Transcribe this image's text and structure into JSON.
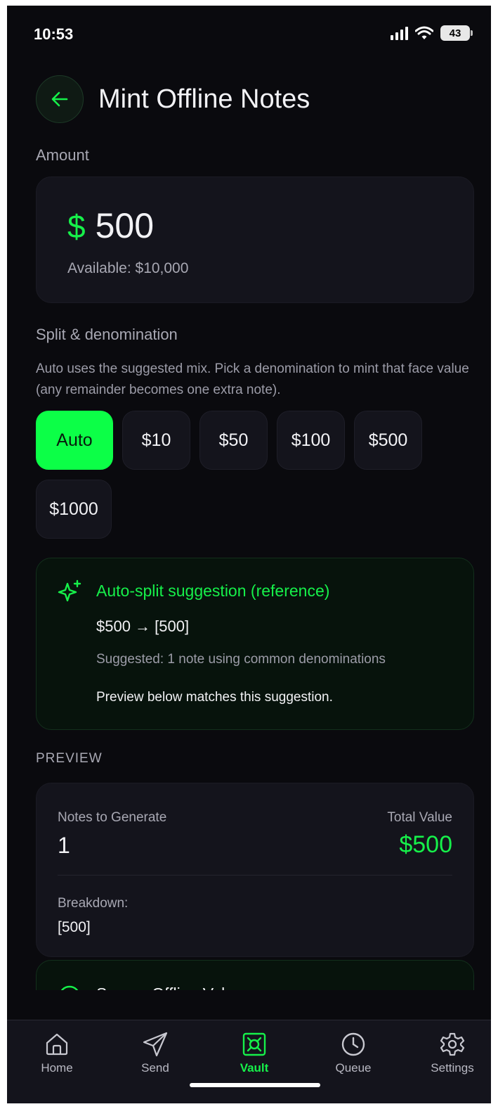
{
  "status_bar": {
    "time": "10:53",
    "battery": "43"
  },
  "header": {
    "title": "Mint Offline Notes"
  },
  "amount": {
    "label": "Amount",
    "currency_symbol": "$",
    "value": "500",
    "available": "Available: $10,000"
  },
  "split": {
    "label": "Split & denomination",
    "description": "Auto uses the suggested mix. Pick a denomination to mint that face value (any remainder becomes one extra note).",
    "options": [
      "Auto",
      "$10",
      "$50",
      "$100",
      "$500",
      "$1000"
    ],
    "selected": "Auto"
  },
  "suggestion": {
    "title": "Auto-split suggestion (reference)",
    "formula": "$500 → [500]",
    "subtitle": "Suggested: 1 note using common denominations",
    "note": "Preview below matches this suggestion."
  },
  "preview": {
    "label": "PREVIEW",
    "notes_label": "Notes to Generate",
    "notes_value": "1",
    "total_label": "Total Value",
    "total_value": "$500",
    "breakdown_label": "Breakdown:",
    "breakdown_value": "[500]"
  },
  "secure_card": {
    "title": "Secure Offline Value"
  },
  "tab_bar": {
    "items": [
      {
        "label": "Home",
        "icon": "home-icon"
      },
      {
        "label": "Send",
        "icon": "send-icon"
      },
      {
        "label": "Vault",
        "icon": "vault-icon",
        "active": true
      },
      {
        "label": "Queue",
        "icon": "clock-icon"
      },
      {
        "label": "Settings",
        "icon": "gear-icon"
      }
    ]
  },
  "colors": {
    "accent": "#16f04a",
    "background": "#0a0a0e",
    "card": "#14141c"
  }
}
